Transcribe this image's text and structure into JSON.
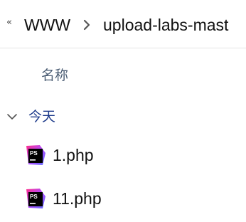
{
  "breadcrumb": {
    "overflow_glyph": "«",
    "items": [
      {
        "label": "WWW"
      },
      {
        "label": "upload-labs-mast"
      }
    ],
    "separator_icon": "chevron-right-icon"
  },
  "list": {
    "column_header": "名称",
    "groups": [
      {
        "label": "今天",
        "expanded": true,
        "chevron_icon": "chevron-down-icon",
        "files": [
          {
            "name": "1.php",
            "icon": "phpstorm-file-icon"
          },
          {
            "name": "11.php",
            "icon": "phpstorm-file-icon"
          }
        ]
      }
    ]
  },
  "colors": {
    "group_label": "#1d3a8a",
    "column_header": "#4a5c73",
    "divider": "#e5e5e5"
  }
}
